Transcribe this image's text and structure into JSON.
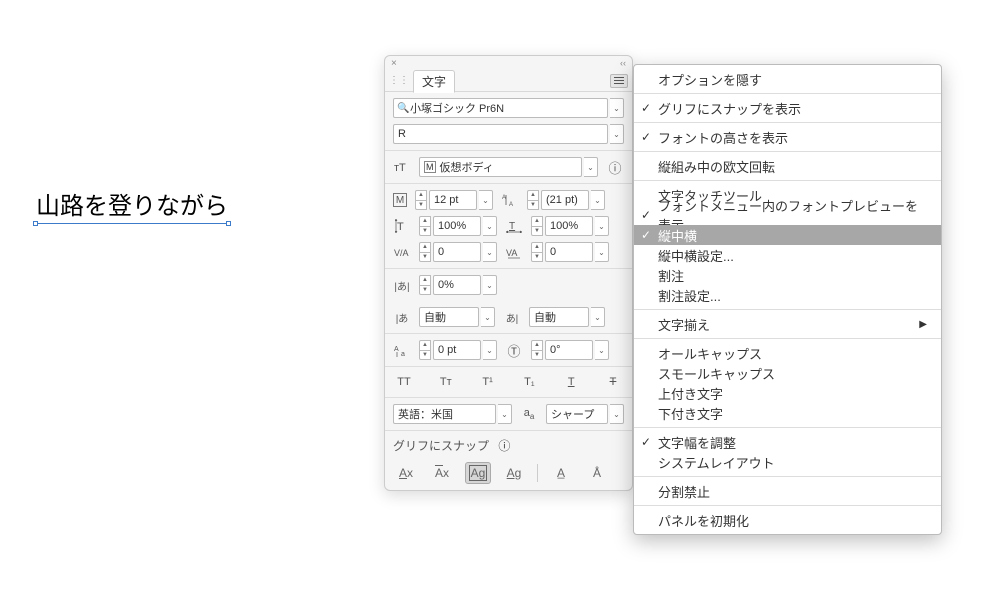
{
  "canvas": {
    "text": "山路を登りながら"
  },
  "panel": {
    "tab": "文字",
    "font_family": "小塚ゴシック Pr6N",
    "font_style": "R",
    "em_box_label": "仮想ボディ",
    "size": "12 pt",
    "leading": "(21 pt)",
    "v_scale": "100%",
    "h_scale": "100%",
    "tracking": "0",
    "tsume": "0",
    "aki_percent": "0%",
    "aki_left": "自動",
    "aki_right": "自動",
    "baseline": "0 pt",
    "rotation": "0°",
    "language": "英語：米国",
    "antialias": "シャープ",
    "snap_label": "グリフにスナップ"
  },
  "menu": {
    "items": [
      {
        "label": "オプションを隠す",
        "checked": false
      },
      {
        "sep": true
      },
      {
        "label": "グリフにスナップを表示",
        "checked": true
      },
      {
        "sep": true
      },
      {
        "label": "フォントの高さを表示",
        "checked": true
      },
      {
        "sep": true
      },
      {
        "label": "縦組み中の欧文回転",
        "checked": false
      },
      {
        "sep": true
      },
      {
        "label": "文字タッチツール",
        "checked": false
      },
      {
        "label": "フォントメニュー内のフォントプレビューを表示",
        "checked": true
      },
      {
        "label": "縦中横",
        "checked": true,
        "highlight": true
      },
      {
        "label": "縦中横設定...",
        "checked": false
      },
      {
        "label": "割注",
        "checked": false
      },
      {
        "label": "割注設定...",
        "checked": false
      },
      {
        "sep": true
      },
      {
        "label": "文字揃え",
        "checked": false,
        "submenu": true
      },
      {
        "sep": true
      },
      {
        "label": "オールキャップス",
        "checked": false
      },
      {
        "label": "スモールキャップス",
        "checked": false
      },
      {
        "label": "上付き文字",
        "checked": false
      },
      {
        "label": "下付き文字",
        "checked": false
      },
      {
        "sep": true
      },
      {
        "label": "文字幅を調整",
        "checked": true
      },
      {
        "label": "システムレイアウト",
        "checked": false
      },
      {
        "sep": true
      },
      {
        "label": "分割禁止",
        "checked": false
      },
      {
        "sep": true
      },
      {
        "label": "パネルを初期化",
        "checked": false
      }
    ]
  }
}
